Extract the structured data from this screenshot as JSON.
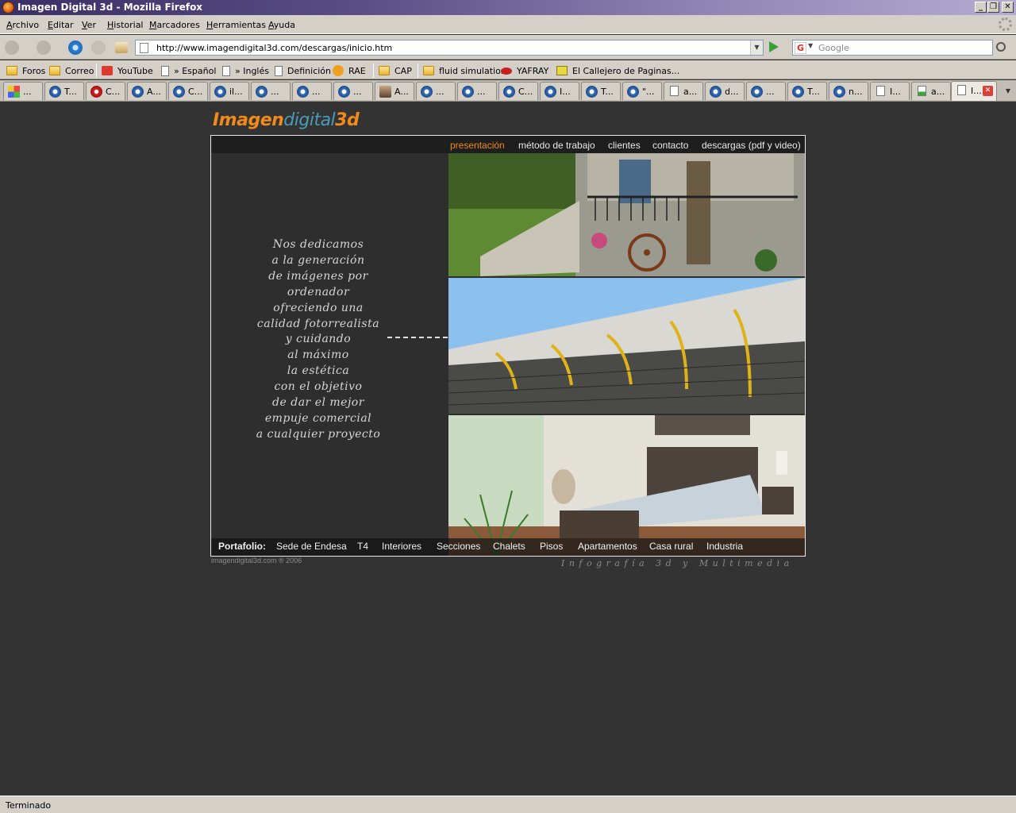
{
  "window": {
    "title": "Imagen Digital 3d - Mozilla Firefox"
  },
  "menu": {
    "items": [
      {
        "u": "A",
        "rest": "rchivo"
      },
      {
        "u": "E",
        "rest": "ditar"
      },
      {
        "u": "V",
        "rest": "er"
      },
      {
        "u": "H",
        "rest": "istorial"
      },
      {
        "u": "M",
        "rest": "arcadores"
      },
      {
        "u": "H",
        "rest": "erramientas"
      },
      {
        "u": "A",
        "rest": "yuda"
      }
    ]
  },
  "nav": {
    "url": "http://www.imagendigital3d.com/descargas/inicio.htm",
    "search_placeholder": "Google"
  },
  "bookmarks": [
    "Foros",
    "Correo",
    "YouTube",
    "» Español",
    "» Inglés",
    "Definición",
    "RAE",
    "CAP",
    "fluid simulation",
    "YAFRAY",
    "El Callejero de Paginas..."
  ],
  "tabs": [
    "...",
    "T...",
    "C...",
    "A...",
    "C...",
    "il...",
    "...",
    "...",
    "...",
    "A...",
    "...",
    "...",
    "C...",
    "I...",
    "T...",
    "\"...",
    "a...",
    "d...",
    "...",
    "T...",
    "n...",
    "I...",
    "a...",
    "I..."
  ],
  "site": {
    "logo": {
      "part1": "Imagen",
      "part2": "digital",
      "part3": "3d"
    },
    "nav": [
      "presentación",
      "método de trabajo",
      "clientes",
      "contacto",
      "descargas (pdf y video)"
    ],
    "slogan": [
      "Nos dedicamos",
      "a la generación",
      "de imágenes por",
      "ordenador",
      "ofreciendo una",
      "calidad fotorrealista",
      "y cuidando",
      "al máximo",
      "la estética",
      "con el objetivo",
      "de dar el mejor",
      "empuje comercial",
      "a cualquier proyecto"
    ],
    "portfolio_label": "Portafolio:",
    "portfolio": [
      "Sede de Endesa",
      "T4",
      "Interiores",
      "Secciones",
      "Chalets",
      "Pisos",
      "Apartamentos",
      "Casa rural",
      "Industria"
    ],
    "copyright": "imagendigital3d.com ® 2006",
    "tagline": "Infografía 3d y Multimedia"
  },
  "status": {
    "text": "Terminado"
  },
  "colors": {
    "accent": "#f08a1c",
    "teal": "#4a9bb8",
    "background": "#333333"
  }
}
